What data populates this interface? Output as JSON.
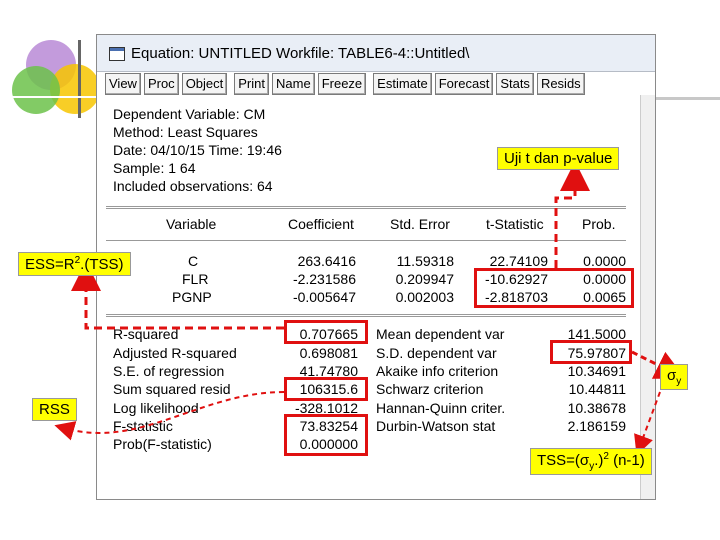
{
  "window": {
    "title": "Equation: UNTITLED   Workfile: TABLE6-4::Untitled\\"
  },
  "toolbar": {
    "buttons": [
      "View",
      "Proc",
      "Object",
      "Print",
      "Name",
      "Freeze",
      "Estimate",
      "Forecast",
      "Stats",
      "Resids"
    ]
  },
  "header": {
    "dependent": "Dependent Variable: CM",
    "method": "Method: Least Squares",
    "date": "Date: 04/10/15   Time: 19:46",
    "sample": "Sample: 1 64",
    "obs": "Included observations: 64"
  },
  "coef_table": {
    "columns": [
      "Variable",
      "Coefficient",
      "Std. Error",
      "t-Statistic",
      "Prob."
    ],
    "rows": [
      [
        "C",
        "263.6416",
        "11.59318",
        "22.74109",
        "0.0000"
      ],
      [
        "FLR",
        "-2.231586",
        "0.209947",
        "-10.62927",
        "0.0000"
      ],
      [
        "PGNP",
        "-0.005647",
        "0.002003",
        "-2.818703",
        "0.0065"
      ]
    ]
  },
  "stats_left": [
    [
      "R-squared",
      "0.707665"
    ],
    [
      "Adjusted R-squared",
      "0.698081"
    ],
    [
      "S.E. of regression",
      "41.74780"
    ],
    [
      "Sum squared resid",
      "106315.6"
    ],
    [
      "Log likelihood",
      "-328.1012"
    ],
    [
      "F-statistic",
      "73.83254"
    ],
    [
      "Prob(F-statistic)",
      "0.000000"
    ]
  ],
  "stats_right": [
    [
      "Mean dependent var",
      "141.5000"
    ],
    [
      "S.D. dependent var",
      "75.97807"
    ],
    [
      "Akaike info criterion",
      "10.34691"
    ],
    [
      "Schwarz criterion",
      "10.44811"
    ],
    [
      "Hannan-Quinn criter.",
      "10.38678"
    ],
    [
      "Durbin-Watson stat",
      "2.186159"
    ]
  ],
  "annotations": {
    "uji": "Uji t dan p-value",
    "ess_prefix": "ESS=R",
    "ess_sup": "2",
    "ess_suffix": ".(TSS)",
    "rss": "RSS",
    "sigma": "σ",
    "sigma_sub": "y",
    "tss_prefix": "TSS=(σ",
    "tss_sub": "y",
    "tss_mid": ".)",
    "tss_sup": "2",
    "tss_suffix": " (n-1)"
  },
  "colors": {
    "highlight_box": "#e01010",
    "annotation_bg": "#ffff00",
    "logo_purple": "#8b3fbf",
    "logo_green": "#4caf50",
    "logo_yellow": "#f7c600"
  }
}
